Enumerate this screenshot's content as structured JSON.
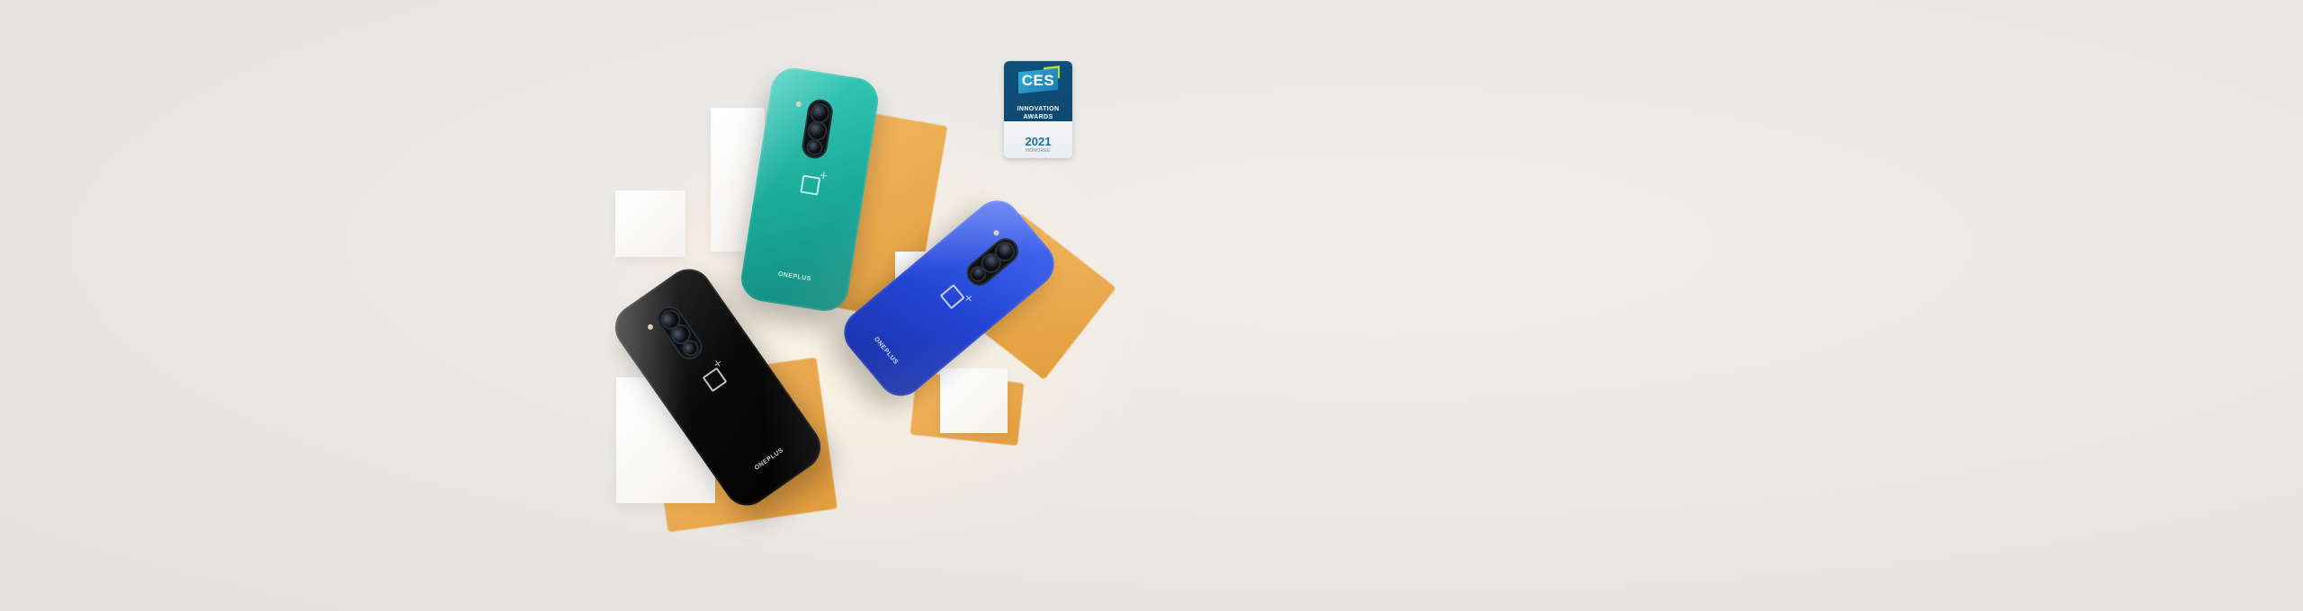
{
  "scene": {
    "description_tag": "oneplus-8-pro-hero",
    "phones": [
      {
        "color_name": "black",
        "body_color": "#0b0b0c",
        "brand_text": "ONEPLUS"
      },
      {
        "color_name": "glacial-green",
        "body_color": "#1fb3a4",
        "brand_text": "ONEPLUS"
      },
      {
        "color_name": "ultramarine-blue",
        "body_color": "#2446d6",
        "brand_text": "ONEPLUS"
      }
    ]
  },
  "badge": {
    "logo_text": "CES",
    "line1": "INNOVATION",
    "line2": "AWARDS",
    "year": "2021",
    "honoree": "HONOREE",
    "colors": {
      "navy": "#0f4f78",
      "cyan": "#33a7d8",
      "lime": "#c7d72f"
    }
  }
}
